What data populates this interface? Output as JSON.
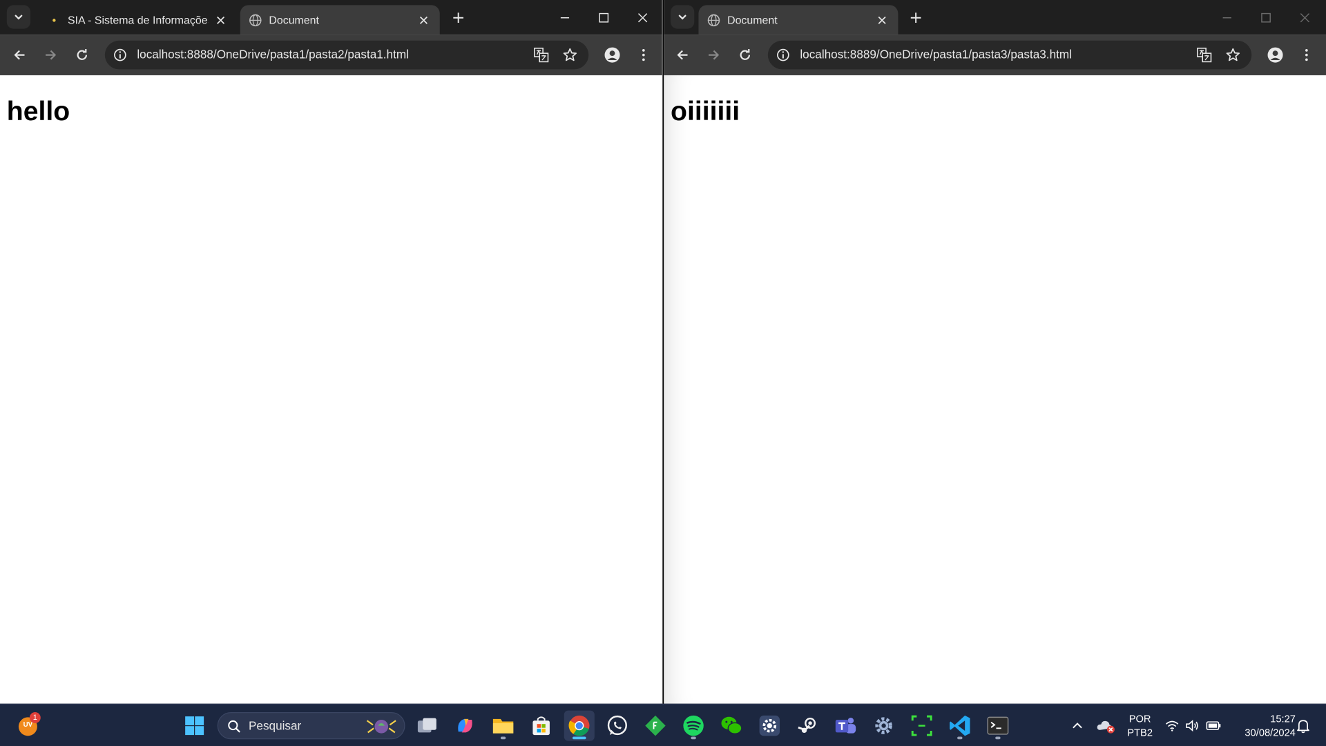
{
  "left_window": {
    "tabs": [
      {
        "title": "SIA - Sistema de Informações A",
        "active": false
      },
      {
        "title": "Document",
        "active": true
      }
    ],
    "url": "localhost:8888/OneDrive/pasta1/pasta2/pasta1.html",
    "heading": "hello"
  },
  "right_window": {
    "tabs": [
      {
        "title": "Document",
        "active": true
      }
    ],
    "url": "localhost:8889/OneDrive/pasta1/pasta3/pasta3.html",
    "heading": "oiiiiiii"
  },
  "taskbar": {
    "widget_badge": "1",
    "widget_label": "UV",
    "search_label": "Pesquisar",
    "language_line1": "POR",
    "language_line2": "PTB2",
    "time": "15:27",
    "date": "30/08/2024"
  },
  "colors": {
    "tabstrip": "#1f1f1f",
    "toolbar": "#3c3c3c",
    "omnibox": "#282828",
    "taskbar": "#1c2740",
    "accent": "#4cc2ff"
  }
}
